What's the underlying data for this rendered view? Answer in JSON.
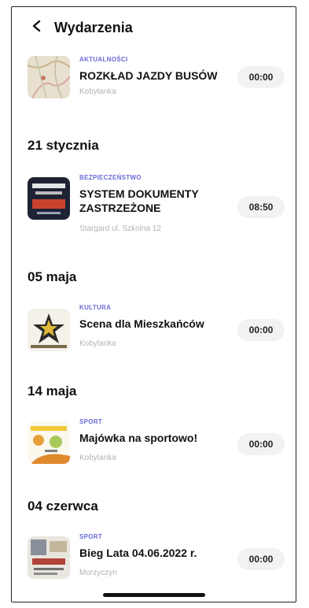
{
  "header": {
    "title": "Wydarzenia",
    "back_icon": "chevron-left-icon"
  },
  "events": [
    {
      "category": "AKTUALNOŚCI",
      "title": "ROZKŁAD JAZDY BUSÓW",
      "location": "Kobylanka",
      "time": "00:00"
    },
    {
      "date": "21 stycznia",
      "category": "BEZPIECZEŃSTWO",
      "title": "SYSTEM DOKUMENTY ZASTRZEŻONE",
      "location": "Stargard ul. Szkolna 12",
      "time": "08:50"
    },
    {
      "date": "05 maja",
      "category": "KULTURA",
      "title": "Scena dla Mieszkańców",
      "location": "Kobylanka",
      "time": "00:00"
    },
    {
      "date": "14 maja",
      "category": "SPORT",
      "title": "Majówka na sportowo!",
      "location": "Kobylanka",
      "time": "00:00"
    },
    {
      "date": "04 czerwca",
      "category": "SPORT",
      "title": "Bieg Lata 04.06.2022 r.",
      "location": "Morzyczyn",
      "time": "00:00"
    }
  ],
  "colors": {
    "category": "#6b6bd6",
    "location": "#b3b3b3",
    "time_pill": "#f2f2f2"
  }
}
